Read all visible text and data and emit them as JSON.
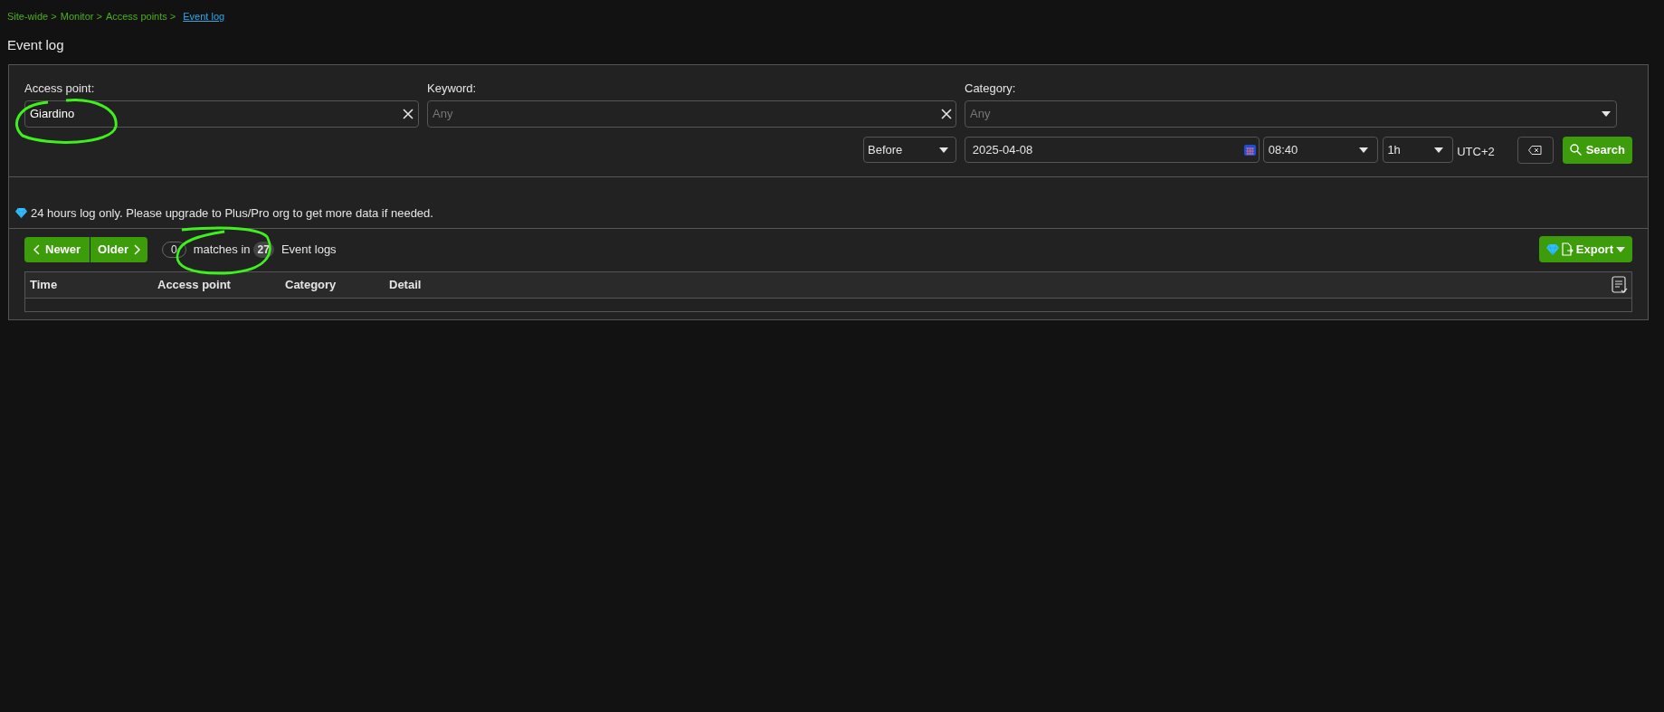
{
  "breadcrumb": {
    "items": [
      "Site-wide >",
      "Monitor >",
      "Access points >"
    ],
    "current": "Event log"
  },
  "title": "Event log",
  "filters": {
    "access_point": {
      "label": "Access point:",
      "value": "Giardino"
    },
    "keyword": {
      "label": "Keyword:",
      "placeholder": "Any"
    },
    "category": {
      "label": "Category:",
      "placeholder": "Any"
    },
    "relation": "Before",
    "date": "2025-04-08",
    "time": "08:40",
    "range": "1h",
    "timezone": "UTC+2",
    "search_button": "Search"
  },
  "notice": "24 hours log only. Please upgrade to Plus/Pro org to get more data if needed.",
  "results": {
    "newer": "Newer",
    "older": "Older",
    "matches": "0",
    "matches_label": "matches in",
    "total": "27",
    "total_label": "Event logs",
    "export": "Export"
  },
  "table": {
    "columns": [
      "Time",
      "Access point",
      "Category",
      "Detail"
    ]
  }
}
